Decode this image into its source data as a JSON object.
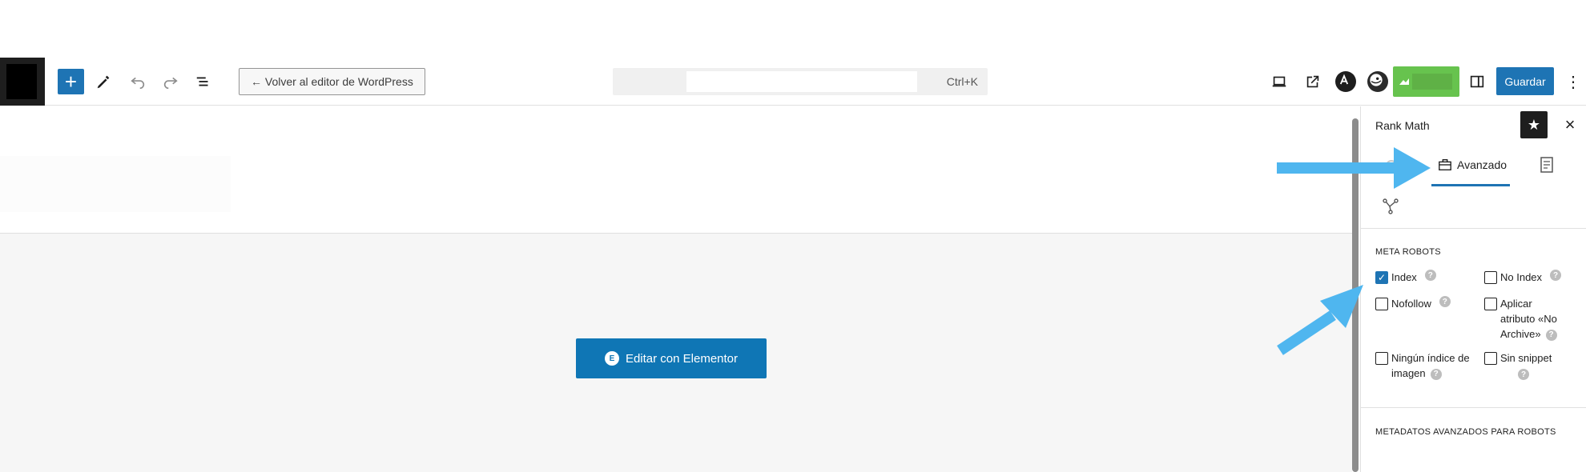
{
  "toolbar": {
    "back_label": "← Volver al editor de WordPress",
    "command_shortcut": "Ctrl+K",
    "save_label": "Guardar"
  },
  "canvas": {
    "edit_elementor_label": "Editar con Elementor"
  },
  "sidebar": {
    "title": "Rank Math",
    "tabs": {
      "advanced_label": "Avanzado"
    },
    "meta_robots_title": "META ROBOTS",
    "checkboxes": [
      {
        "label": "Index",
        "checked": true
      },
      {
        "label": "No Index",
        "checked": false
      },
      {
        "label": "Nofollow",
        "checked": false
      },
      {
        "label_lines": [
          "Aplicar",
          "atributo «No",
          "Archive»"
        ],
        "checked": false
      },
      {
        "label_lines": [
          "Ningún índice de",
          "imagen"
        ],
        "checked": false
      },
      {
        "label": "Sin snippet",
        "checked": false
      }
    ],
    "advanced_robots_title": "METADATOS AVANZADOS PARA ROBOTS"
  },
  "colors": {
    "accent": "#1e74b4",
    "arrow": "#4fb6ef",
    "green": "#67c34e"
  },
  "icons": [
    "wordpress-logo-icon",
    "plus-icon",
    "pen-icon",
    "undo-icon",
    "redo-icon",
    "list-view-icon",
    "desktop-icon",
    "external-link-icon",
    "astra-icon",
    "bird-icon",
    "sidebar-toggle-icon",
    "more-vertical-icon",
    "star-icon",
    "close-icon",
    "gear-icon",
    "toolbox-icon",
    "document-icon",
    "schema-icon",
    "help-icon",
    "elementor-icon"
  ]
}
